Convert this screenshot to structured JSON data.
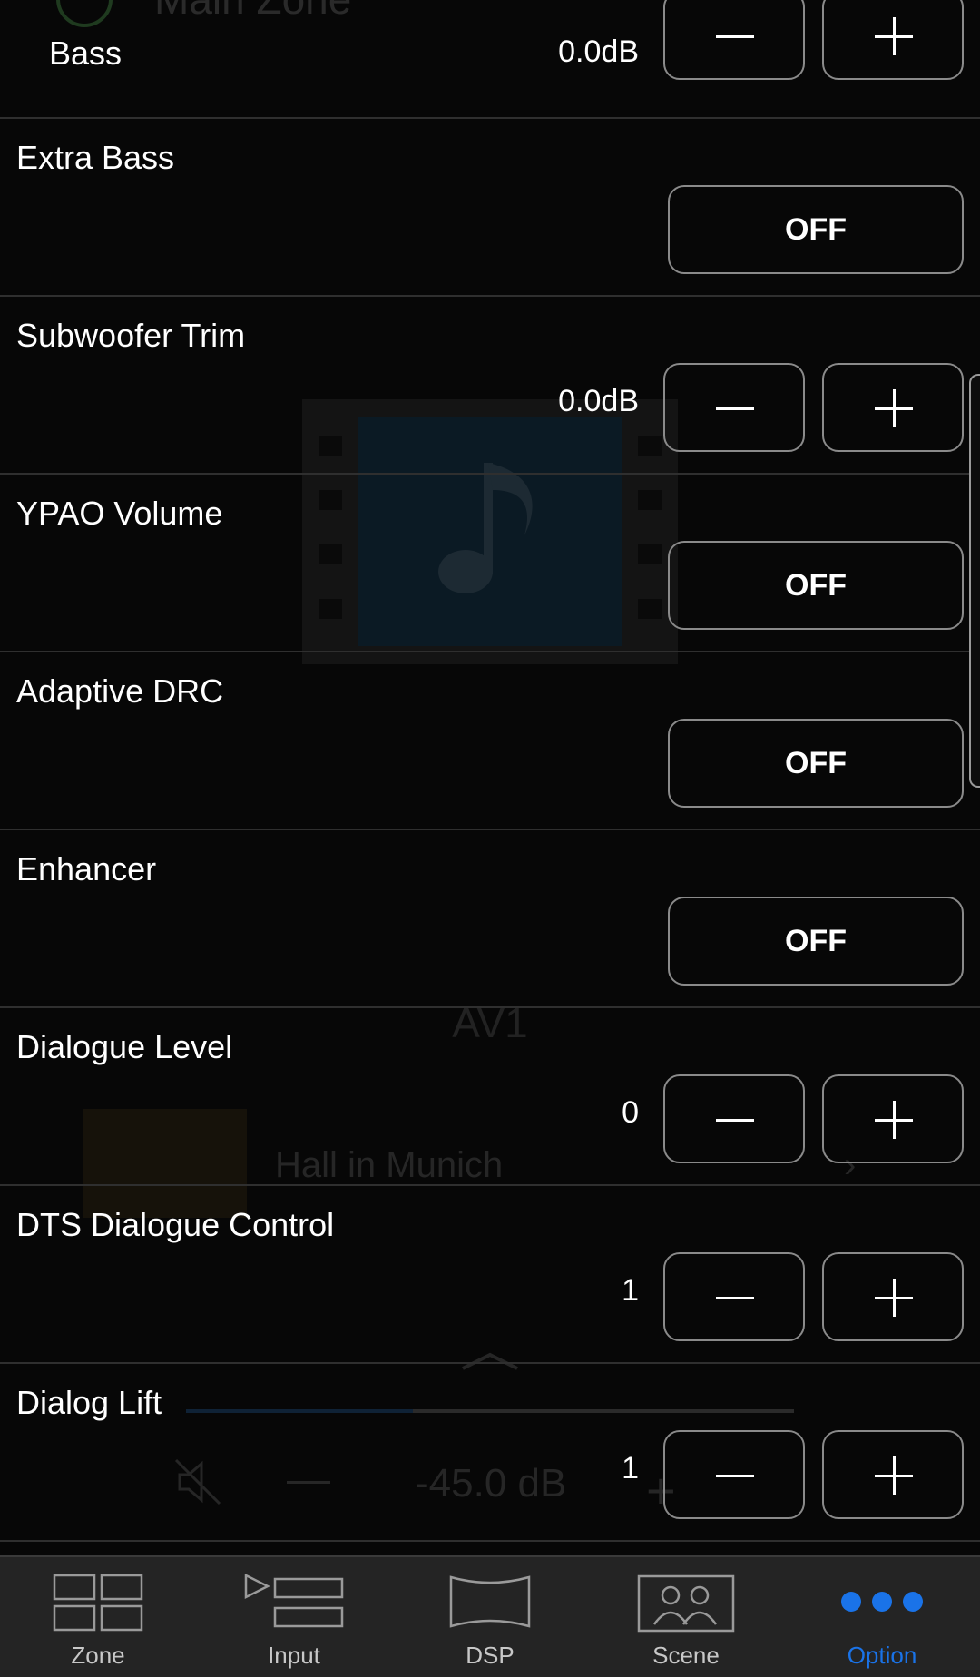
{
  "background": {
    "zone_title": "Main Zone",
    "input_name": "AV1",
    "dsp_program": "Hall in Munich",
    "volume": "-45.0 dB"
  },
  "options": [
    {
      "label": "Bass",
      "value": "0.0dB",
      "control": "stepper"
    },
    {
      "label": "Extra Bass",
      "value": "OFF",
      "control": "toggle"
    },
    {
      "label": "Subwoofer Trim",
      "value": "0.0dB",
      "control": "stepper"
    },
    {
      "label": "YPAO Volume",
      "value": "OFF",
      "control": "toggle"
    },
    {
      "label": "Adaptive DRC",
      "value": "OFF",
      "control": "toggle"
    },
    {
      "label": "Enhancer",
      "value": "OFF",
      "control": "toggle"
    },
    {
      "label": "Dialogue Level",
      "value": "0",
      "control": "stepper"
    },
    {
      "label": "DTS Dialogue Control",
      "value": "1",
      "control": "stepper"
    },
    {
      "label": "Dialog Lift",
      "value": "1",
      "control": "stepper"
    }
  ],
  "tabs": [
    {
      "label": "Zone",
      "icon": "zone-icon",
      "active": false
    },
    {
      "label": "Input",
      "icon": "input-icon",
      "active": false
    },
    {
      "label": "DSP",
      "icon": "dsp-icon",
      "active": false
    },
    {
      "label": "Scene",
      "icon": "scene-icon",
      "active": false
    },
    {
      "label": "Option",
      "icon": "option-dots-icon",
      "active": true
    }
  ],
  "colors": {
    "accent": "#1a73e8",
    "background": "#070707",
    "button_border": "#8a8a8a"
  }
}
